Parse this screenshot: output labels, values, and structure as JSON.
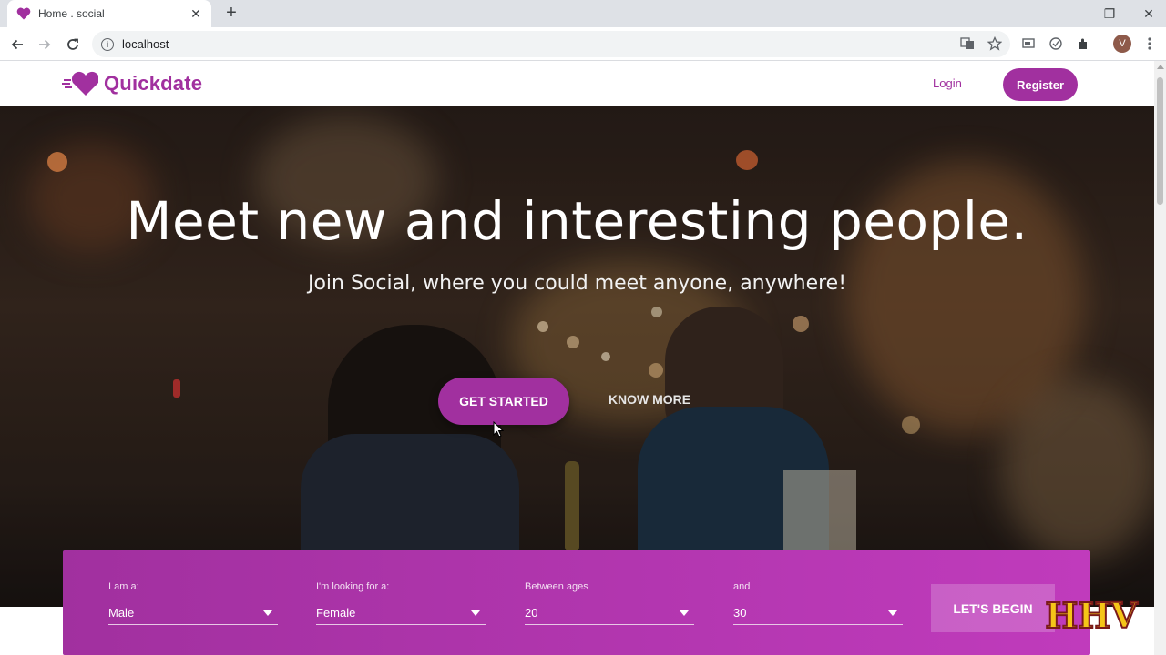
{
  "browser": {
    "tab_title": "Home . social",
    "tab_close": "✕",
    "new_tab": "+",
    "url": "localhost",
    "profile_initial": "V",
    "window_controls": [
      "–",
      "❐",
      "✕"
    ]
  },
  "site": {
    "brand": "Quickdate",
    "brand_color": "#a1309f",
    "nav": {
      "login": "Login",
      "register": "Register"
    }
  },
  "hero": {
    "title": "Meet new and interesting people.",
    "subtitle": "Join Social, where you could meet anyone, anywhere!",
    "primary_cta": "GET STARTED",
    "secondary_cta": "KNOW MORE"
  },
  "search": {
    "fields": [
      {
        "label": "I am a:",
        "value": "Male"
      },
      {
        "label": "I'm looking for a:",
        "value": "Female"
      },
      {
        "label": "Between ages",
        "value": "20"
      },
      {
        "label": "and",
        "value": "30"
      }
    ],
    "submit": "LET'S BEGIN"
  },
  "watermark": "HHV"
}
